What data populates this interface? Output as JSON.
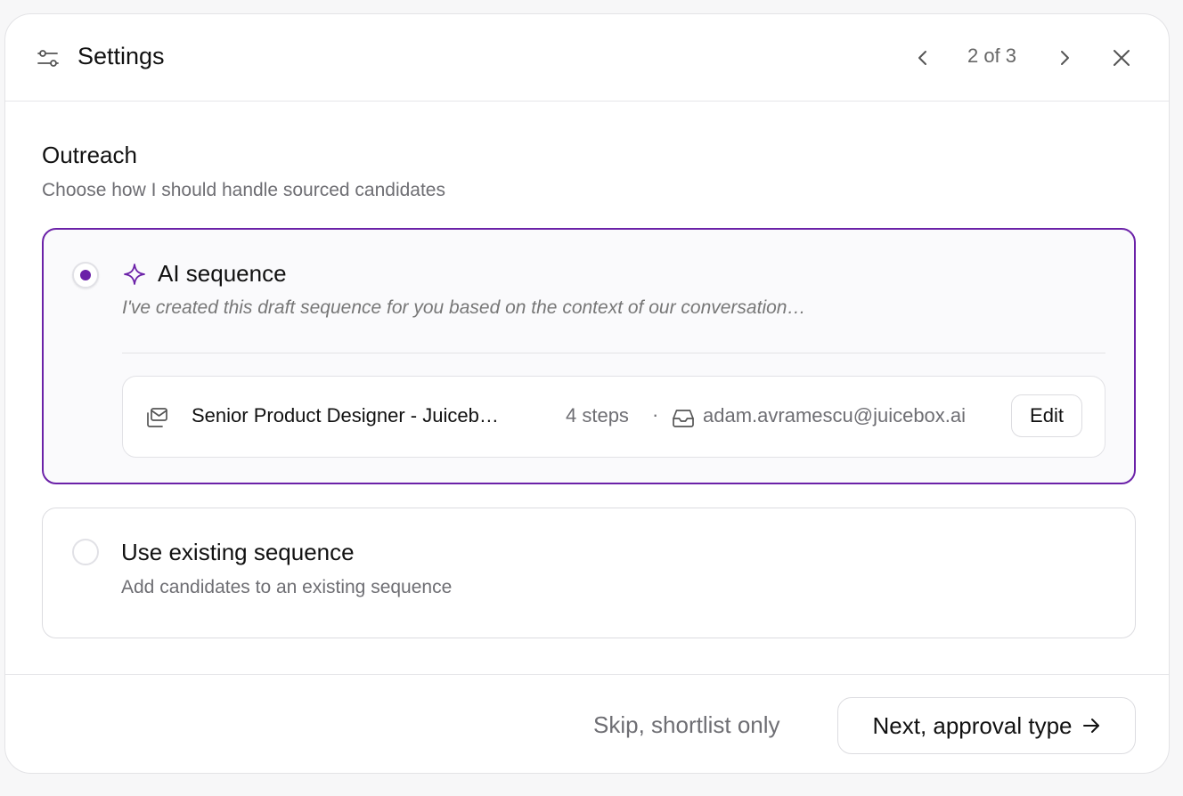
{
  "header": {
    "title": "Settings",
    "pager": "2 of 3",
    "icons": [
      "settings-sliders-icon",
      "chevron-left-icon",
      "chevron-right-icon",
      "close-icon"
    ]
  },
  "section": {
    "title": "Outreach",
    "subtitle": "Choose how I should handle sourced candidates"
  },
  "options": [
    {
      "title": "AI sequence",
      "description": "I've created this draft sequence for you based on the context of our conversation…",
      "selected": true,
      "icon": "sparkle-icon",
      "sequence": {
        "name": "Senior Product Designer - Juiceb…",
        "steps": "4 steps",
        "separator": "·",
        "email": "adam.avramescu@juicebox.ai",
        "edit_label": "Edit",
        "icons": [
          "mail-stack-icon",
          "inbox-icon"
        ]
      }
    },
    {
      "title": "Use existing sequence",
      "description": "Add candidates to an existing sequence",
      "selected": false
    }
  ],
  "footer": {
    "skip_label": "Skip, shortlist only",
    "next_label": "Next, approval type"
  },
  "colors": {
    "accent": "#6b21a8",
    "border": "#dcdce0",
    "muted_text": "#6e6e73"
  }
}
